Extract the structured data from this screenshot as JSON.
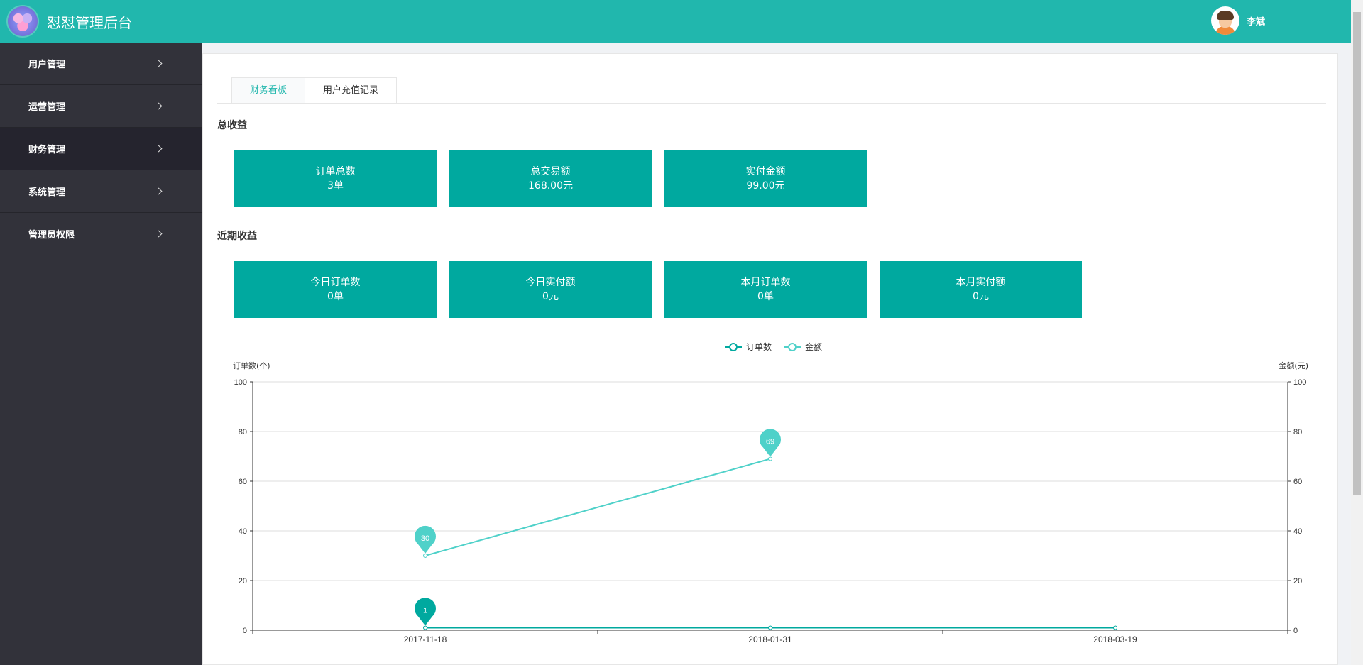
{
  "header": {
    "app_title": "怼怼管理后台",
    "user_name": "李斌",
    "brand_color": "#21b7ad"
  },
  "sidebar": {
    "items": [
      {
        "label": "用户管理",
        "icon": "chevron-right-icon"
      },
      {
        "label": "运营管理",
        "icon": "chevron-right-icon"
      },
      {
        "label": "财务管理",
        "icon": "chevron-right-icon"
      },
      {
        "label": "系统管理",
        "icon": "chevron-right-icon"
      },
      {
        "label": "管理员权限",
        "icon": "chevron-right-icon"
      }
    ],
    "active_index": 2
  },
  "tabs": [
    {
      "label": "财务看板"
    },
    {
      "label": "用户充值记录"
    }
  ],
  "total_section": {
    "title": "总收益",
    "cards": [
      {
        "label": "订单总数",
        "value": "3单"
      },
      {
        "label": "总交易额",
        "value": "168.00元"
      },
      {
        "label": "实付金额",
        "value": "99.00元"
      }
    ]
  },
  "recent_section": {
    "title": "近期收益",
    "cards": [
      {
        "label": "今日订单数",
        "value": "0单"
      },
      {
        "label": "今日实付额",
        "value": "0元"
      },
      {
        "label": "本月订单数",
        "value": "0单"
      },
      {
        "label": "本月实付额",
        "value": "0元"
      }
    ]
  },
  "chart_data": {
    "type": "line",
    "categories": [
      "2017-11-18",
      "2018-01-31",
      "2018-03-19"
    ],
    "series": [
      {
        "name": "订单数",
        "values": [
          1,
          1,
          1
        ],
        "color": "#00a99f",
        "axis": "left",
        "markers": [
          {
            "index": 0,
            "label": "1"
          }
        ]
      },
      {
        "name": "金额",
        "values": [
          30,
          69
        ],
        "color": "#4fd1c9",
        "axis": "right",
        "markers": [
          {
            "index": 0,
            "label": "30"
          },
          {
            "index": 1,
            "label": "69"
          }
        ]
      }
    ],
    "ylabel_left": "订单数(个)",
    "ylabel_right": "金额(元)",
    "ylim": [
      0,
      100
    ],
    "yticks": [
      0,
      20,
      40,
      60,
      80,
      100
    ],
    "grid": true,
    "legend": "top-center"
  }
}
